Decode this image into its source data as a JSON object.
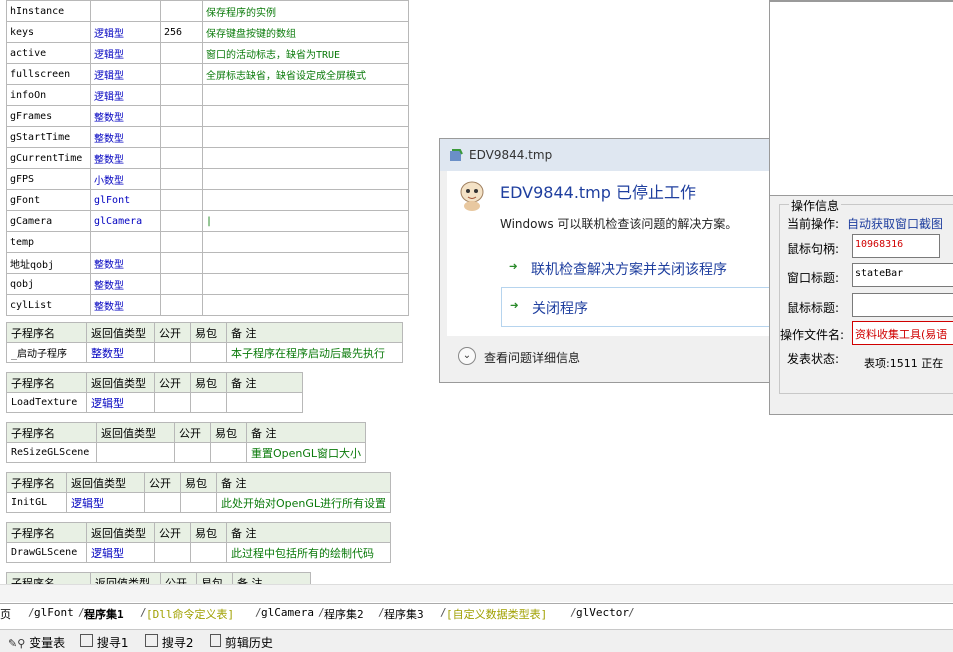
{
  "variables": [
    {
      "name": "hInstance",
      "type": "",
      "size": "",
      "note": "保存程序的实例"
    },
    {
      "name": "keys",
      "type": "逻辑型",
      "size": "256",
      "note": "保存键盘按键的数组"
    },
    {
      "name": "active",
      "type": "逻辑型",
      "size": "",
      "note": "窗口的活动标志，缺省为TRUE"
    },
    {
      "name": "fullscreen",
      "type": "逻辑型",
      "size": "",
      "note": "全屏标志缺省，缺省设定成全屏模式"
    },
    {
      "name": "infoOn",
      "type": "逻辑型",
      "size": "",
      "note": ""
    },
    {
      "name": "gFrames",
      "type": "整数型",
      "size": "",
      "note": ""
    },
    {
      "name": "gStartTime",
      "type": "整数型",
      "size": "",
      "note": ""
    },
    {
      "name": "gCurrentTime",
      "type": "整数型",
      "size": "",
      "note": ""
    },
    {
      "name": "gFPS",
      "type": "小数型",
      "size": "",
      "note": ""
    },
    {
      "name": "gFont",
      "type": "glFont",
      "size": "",
      "note": ""
    },
    {
      "name": "gCamera",
      "type": "glCamera",
      "size": "",
      "note": "|"
    },
    {
      "name": "temp",
      "type": "",
      "size": "",
      "note": ""
    },
    {
      "name": "地址qobj",
      "type": "整数型",
      "size": "",
      "note": ""
    },
    {
      "name": "qobj",
      "type": "整数型",
      "size": "",
      "note": ""
    },
    {
      "name": "cylList",
      "type": "整数型",
      "size": "",
      "note": ""
    }
  ],
  "sub_headers": {
    "name": "子程序名",
    "ret": "返回值类型",
    "pub": "公开",
    "pack": "易包",
    "note": "备 注"
  },
  "subs": [
    {
      "name": "_启动子程序",
      "ret": "整数型",
      "note": "本子程序在程序启动后最先执行"
    },
    {
      "name": "LoadTexture",
      "ret": "逻辑型",
      "note": ""
    },
    {
      "name": "ReSizeGLScene",
      "ret": "",
      "note": "重置OpenGL窗口大小"
    },
    {
      "name": "InitGL",
      "ret": "逻辑型",
      "note": "此处开始对OpenGL进行所有设置"
    },
    {
      "name": "DrawGLScene",
      "ret": "逻辑型",
      "note": "此过程中包括所有的绘制代码"
    },
    {
      "name": "",
      "ret": "",
      "note": ""
    }
  ],
  "dialog": {
    "title": "EDV9844.tmp",
    "heading": "EDV9844.tmp 已停止工作",
    "message": "Windows 可以联机检查该问题的解决方案。",
    "option1": "联机检查解决方案并关闭该程序",
    "option2": "关闭程序",
    "details": "查看问题详细信息"
  },
  "panel": {
    "group_title": "操作信息",
    "op_label": "当前操作:",
    "op_value": "自动获取窗口截图",
    "handle_label": "鼠标句柄:",
    "handle_value": "10968316",
    "wtitle_label": "窗口标题:",
    "wtitle_value": "stateBar",
    "mtitle_label": "鼠标标题:",
    "mtitle_value": "",
    "file_label": "操作文件名:",
    "file_value": "资料收集工具(易语",
    "status_label": "发表状态:",
    "status_value": "表项:1511 正在"
  },
  "tabs": [
    "页",
    "glFont",
    "程序集1",
    "[Dll命令定义表]",
    "glCamera",
    "程序集2",
    "程序集3",
    "[自定义数据类型表]",
    "glVector"
  ],
  "bottom": [
    "变量表",
    "搜寻1",
    "搜寻2",
    "剪辑历史"
  ],
  "colors": {
    "type_blue": "#0000c0",
    "note_green": "#0a7a0a",
    "title_blue": "#1f3f9f",
    "red": "#d00000"
  }
}
